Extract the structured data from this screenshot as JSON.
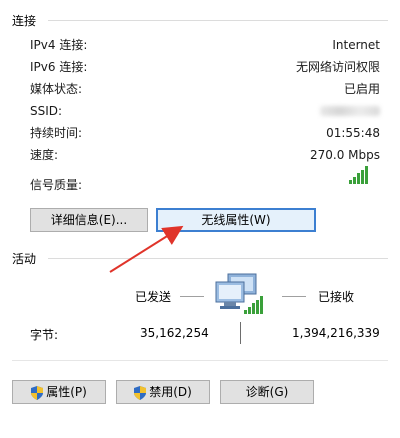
{
  "connection": {
    "title": "连接",
    "rows": [
      {
        "label": "IPv4 连接:",
        "value": "Internet"
      },
      {
        "label": "IPv6 连接:",
        "value": "无网络访问权限"
      },
      {
        "label": "媒体状态:",
        "value": "已启用"
      },
      {
        "label": "SSID:",
        "value": ""
      },
      {
        "label": "持续时间:",
        "value": "01:55:48"
      },
      {
        "label": "速度:",
        "value": "270.0 Mbps"
      }
    ],
    "signal_label": "信号质量:",
    "signal_bars_lit": 5,
    "signal_bars_total": 5,
    "details_button": "详细信息(E)...",
    "wireless_props_button": "无线属性(W)"
  },
  "activity": {
    "title": "活动",
    "sent_label": "已发送",
    "received_label": "已接收",
    "bytes_label": "字节:",
    "bytes_sent": "35,162,254",
    "bytes_received": "1,394,216,339"
  },
  "footer": {
    "properties_button": "属性(P)",
    "disable_button": "禁用(D)",
    "diagnose_button": "诊断(G)"
  },
  "colors": {
    "accent": "#3c7fd1",
    "signal": "#3aa03a",
    "arrow": "#e0342a",
    "button_bg": "#e1e1e1"
  },
  "icons": [
    "network-computer-icon",
    "signal-strength-icon",
    "shield-icon",
    "red-arrow-annotation"
  ]
}
